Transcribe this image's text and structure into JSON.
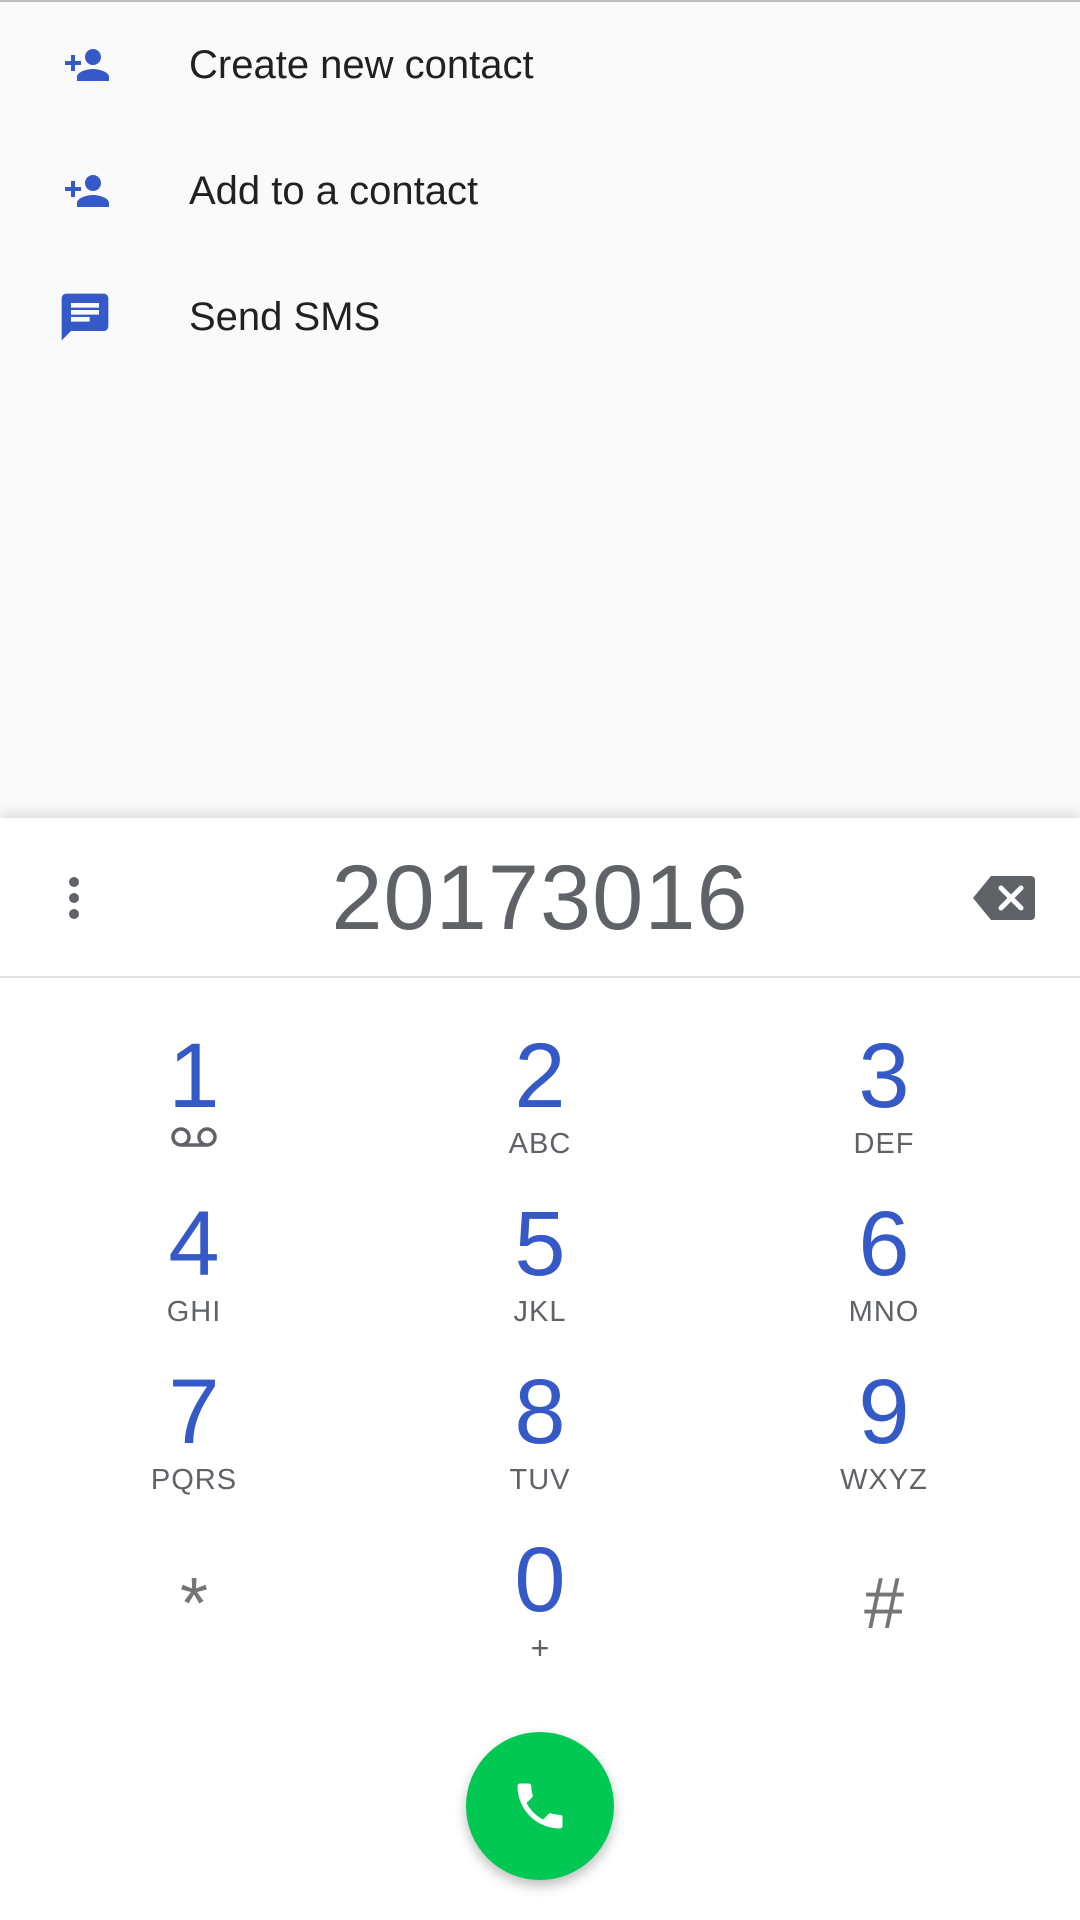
{
  "actions": [
    {
      "label": "Create new contact",
      "icon": "person-add-icon"
    },
    {
      "label": "Add to a contact",
      "icon": "person-add-icon"
    },
    {
      "label": "Send SMS",
      "icon": "message-icon"
    }
  ],
  "dialpad": {
    "digits": "20173016",
    "keys": [
      {
        "num": "1",
        "letters": ""
      },
      {
        "num": "2",
        "letters": "ABC"
      },
      {
        "num": "3",
        "letters": "DEF"
      },
      {
        "num": "4",
        "letters": "GHI"
      },
      {
        "num": "5",
        "letters": "JKL"
      },
      {
        "num": "6",
        "letters": "MNO"
      },
      {
        "num": "7",
        "letters": "PQRS"
      },
      {
        "num": "8",
        "letters": "TUV"
      },
      {
        "num": "9",
        "letters": "WXYZ"
      },
      {
        "num": "*",
        "letters": ""
      },
      {
        "num": "0",
        "letters": "+"
      },
      {
        "num": "#",
        "letters": ""
      }
    ]
  },
  "colors": {
    "accent": "#3559c7",
    "call": "#00c853",
    "digit_text": "#5f6368"
  }
}
